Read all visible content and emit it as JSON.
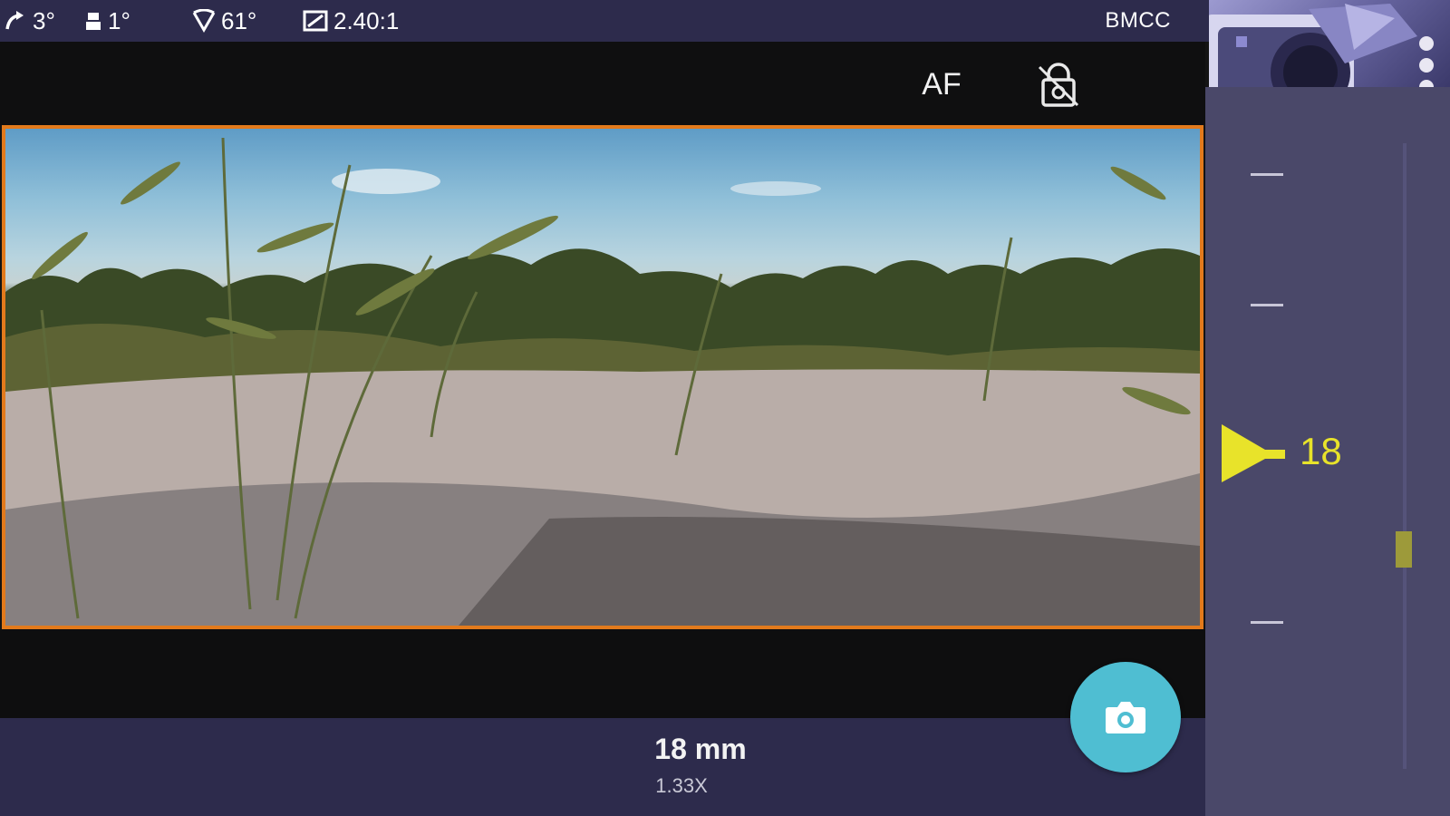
{
  "status_bar": {
    "roll": "3°",
    "pitch": "1°",
    "fov": "61°",
    "aspect_ratio": "2.40:1",
    "camera_model": "BMCC"
  },
  "toolbar": {
    "af_label": "AF"
  },
  "lens": {
    "focal_length": "18 mm",
    "crop_factor": "1.33X"
  },
  "ruler": {
    "current_value": "18"
  },
  "colors": {
    "bar_background": "#2d2b4c",
    "panel_background": "#4a4869",
    "frame_border": "#e27a1c",
    "shutter_button": "#4fbed2",
    "pointer_yellow": "#e8e32a"
  },
  "icons": {
    "roll": "tilt-arrow-icon",
    "pitch": "level-icon",
    "fov": "field-of-view-icon",
    "aspect_ratio": "aspect-ratio-icon",
    "lock": "rotation-lock-icon",
    "shutter": "camera-icon",
    "menu": "more-vert-icon"
  }
}
